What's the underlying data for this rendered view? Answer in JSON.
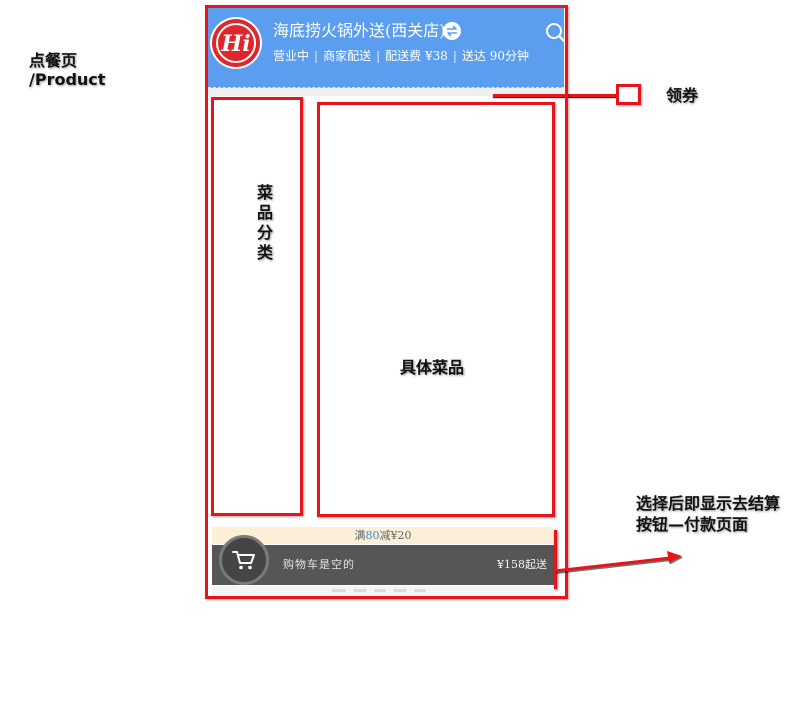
{
  "annotations": {
    "page_title": "点餐页",
    "page_route": "/Product",
    "coupon_label": "领券",
    "category_label": "菜品分类",
    "dishes_label": "具体菜品",
    "checkout_note": [
      "选择后即显示去结算",
      "按钮—付款页面"
    ]
  },
  "header": {
    "logo_text": "Hi",
    "store_name": "海底捞火锅外送(西关店)",
    "status_items": [
      "营业中",
      "商家配送",
      "配送费 ¥38",
      "送达 90分钟"
    ],
    "separator": "|"
  },
  "promo": {
    "prefix": "满",
    "amount": "80",
    "suffix": "减¥20"
  },
  "cart": {
    "empty_text": "购物车是空的",
    "min_order": "¥158起送"
  },
  "icons": {
    "logo": "hi-logo-icon",
    "swap": "swap-icon",
    "search": "search-icon",
    "cart": "cart-icon"
  },
  "colors": {
    "annotation_red": "#e8131b",
    "header_bg": "#5b9ef0",
    "promo_bg": "#fbefd8",
    "promo_amount": "#3f86e0",
    "cart_bar_bg": "#565656"
  }
}
